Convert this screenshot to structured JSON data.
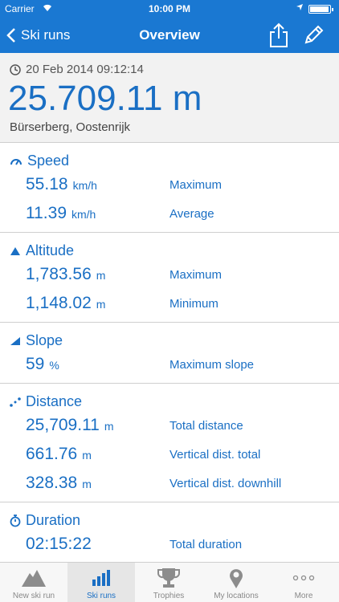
{
  "status_bar": {
    "carrier": "Carrier",
    "time": "10:00 PM"
  },
  "nav": {
    "back_label": "Ski runs",
    "title": "Overview"
  },
  "header": {
    "date": "20 Feb 2014 09:12:14",
    "distance": "25.709.11 m",
    "location": "Bürserberg, Oostenrijk"
  },
  "speed": {
    "title": "Speed",
    "rows": [
      {
        "value": "55.18",
        "unit": "km/h",
        "label": "Maximum"
      },
      {
        "value": "11.39",
        "unit": "km/h",
        "label": "Average"
      }
    ]
  },
  "altitude": {
    "title": "Altitude",
    "rows": [
      {
        "value": "1,783.56",
        "unit": "m",
        "label": "Maximum"
      },
      {
        "value": "1,148.02",
        "unit": "m",
        "label": "Minimum"
      }
    ]
  },
  "slope": {
    "title": "Slope",
    "rows": [
      {
        "value": "59",
        "unit": "%",
        "label": "Maximum slope"
      }
    ]
  },
  "distance": {
    "title": "Distance",
    "rows": [
      {
        "value": "25,709.11",
        "unit": "m",
        "label": "Total distance"
      },
      {
        "value": "661.76",
        "unit": "m",
        "label": "Vertical dist. total"
      },
      {
        "value": "328.38",
        "unit": "m",
        "label": "Vertical dist. downhill"
      }
    ]
  },
  "duration": {
    "title": "Duration",
    "rows": [
      {
        "value": "02:15:22",
        "unit": "",
        "label": "Total duration"
      }
    ]
  },
  "tabs": [
    {
      "label": "New ski run",
      "icon": "mountain-icon"
    },
    {
      "label": "Ski runs",
      "icon": "bar-chart-icon"
    },
    {
      "label": "Trophies",
      "icon": "trophy-icon"
    },
    {
      "label": "My locations",
      "icon": "location-pin-icon"
    },
    {
      "label": "More",
      "icon": "more-dots-icon"
    }
  ],
  "colors": {
    "accent": "#1a78d2",
    "text_blue": "#1a6fc4",
    "header_bg": "#f2f2f2"
  }
}
